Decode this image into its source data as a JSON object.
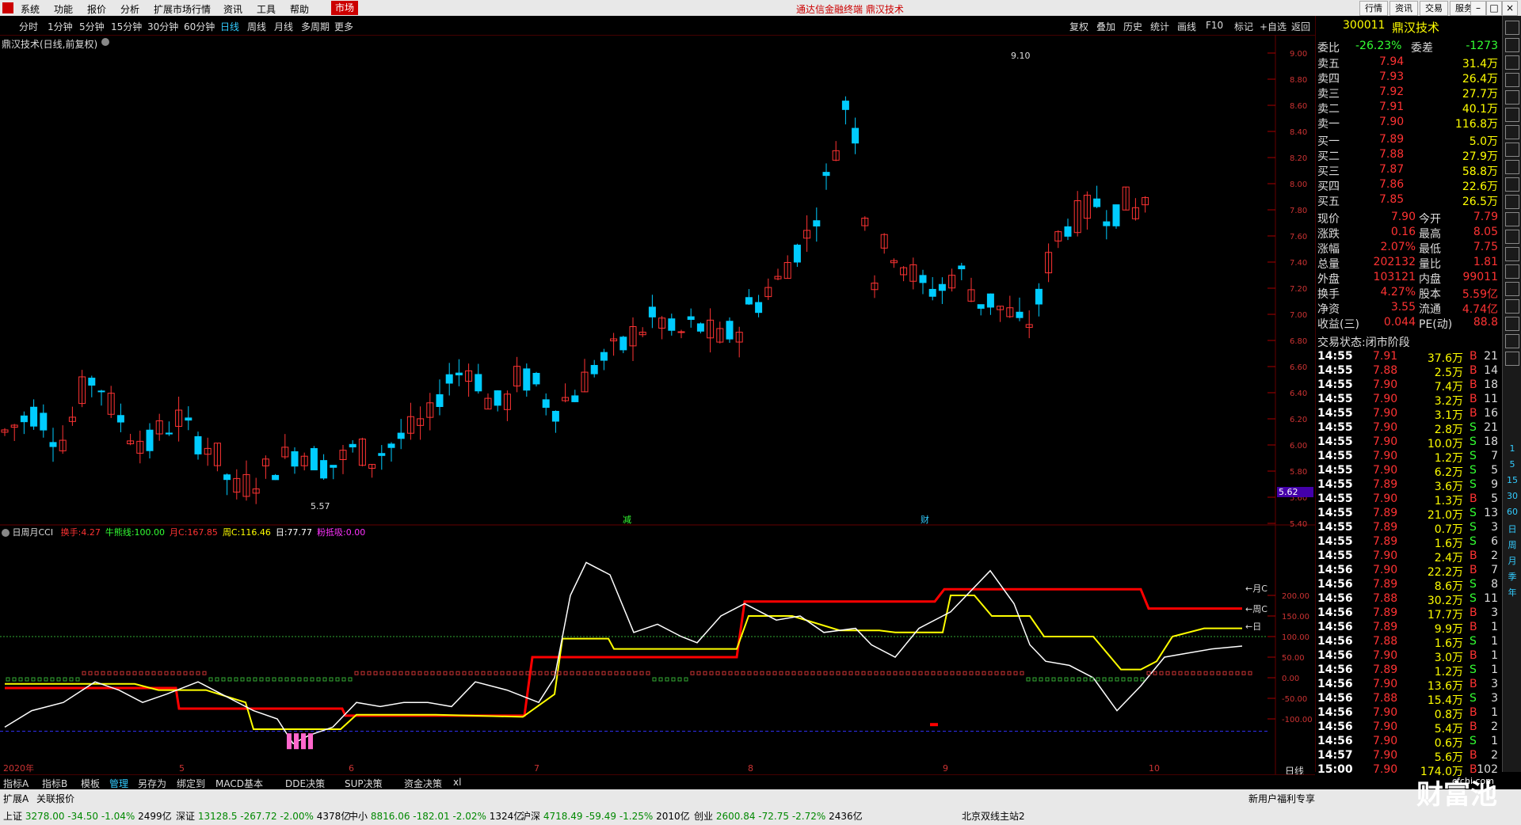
{
  "menubar": {
    "items": [
      "系统",
      "功能",
      "报价",
      "分析",
      "扩展市场行情",
      "资讯",
      "工具",
      "帮助"
    ],
    "market_tab": "市场",
    "center_title": "通达信金融终端  鼎汉技术",
    "right_buttons": [
      "行情",
      "资讯",
      "交易",
      "服务"
    ]
  },
  "period_toolbar": {
    "items": [
      "分时",
      "1分钟",
      "5分钟",
      "15分钟",
      "30分钟",
      "60分钟",
      "日线",
      "周线",
      "月线",
      "多周期",
      "更多"
    ],
    "active": "日线",
    "right_items": [
      "复权",
      "叠加",
      "历史",
      "统计",
      "画线",
      "F10",
      "标记",
      "+自选",
      "返回"
    ]
  },
  "chart": {
    "title": "鼎汉技术(日线,前复权)",
    "price_axis": [
      "9.00",
      "8.80",
      "8.60",
      "8.40",
      "8.20",
      "8.00",
      "7.80",
      "7.60",
      "7.40",
      "7.20",
      "7.00",
      "6.80",
      "6.60",
      "6.40",
      "6.20",
      "6.00",
      "5.80",
      "5.60",
      "5.40"
    ],
    "current_price_tag": "5.62",
    "high_mark": "9.10",
    "low_mark": "5.57",
    "event_marks": [
      "减",
      "财"
    ],
    "indicator": {
      "name": "日周月CCI",
      "params": [
        {
          "label": "换手:",
          "value": "4.27",
          "color": "#f33"
        },
        {
          "label": "牛熊线:",
          "value": "100.00",
          "color": "#3f3"
        },
        {
          "label": "月C:",
          "value": "167.85",
          "color": "#f33"
        },
        {
          "label": "周C:",
          "value": "116.46",
          "color": "#ff0"
        },
        {
          "label": "日:",
          "value": "77.77",
          "color": "#fff"
        },
        {
          "label": "粉抵吸:",
          "value": "0.00",
          "color": "#f3f"
        }
      ],
      "axis": [
        "200.00",
        "150.00",
        "100.00",
        "50.00",
        "0.00",
        "-50.00",
        "-100.00"
      ],
      "line_labels": [
        "←月C",
        "←周C",
        "←日"
      ]
    },
    "date_axis": [
      "2020年",
      "5",
      "6",
      "7",
      "8",
      "9",
      "10"
    ],
    "period_label": "日线"
  },
  "right_panel": {
    "code": "300011",
    "name": "鼎汉技术",
    "weibi_label": "委比",
    "weibi": "-26.23%",
    "weicha_label": "委差",
    "weicha": "-1273",
    "sell": [
      {
        "label": "卖五",
        "price": "7.94",
        "vol": "31.4万"
      },
      {
        "label": "卖四",
        "price": "7.93",
        "vol": "26.4万"
      },
      {
        "label": "卖三",
        "price": "7.92",
        "vol": "27.7万"
      },
      {
        "label": "卖二",
        "price": "7.91",
        "vol": "40.1万"
      },
      {
        "label": "卖一",
        "price": "7.90",
        "vol": "116.8万"
      }
    ],
    "buy": [
      {
        "label": "买一",
        "price": "7.89",
        "vol": "5.0万"
      },
      {
        "label": "买二",
        "price": "7.88",
        "vol": "27.9万"
      },
      {
        "label": "买三",
        "price": "7.87",
        "vol": "58.8万"
      },
      {
        "label": "买四",
        "price": "7.86",
        "vol": "22.6万"
      },
      {
        "label": "买五",
        "price": "7.85",
        "vol": "26.5万"
      }
    ],
    "stats": [
      {
        "l1": "现价",
        "v1": "7.90",
        "l2": "今开",
        "v2": "7.79"
      },
      {
        "l1": "涨跌",
        "v1": "0.16",
        "l2": "最高",
        "v2": "8.05"
      },
      {
        "l1": "涨幅",
        "v1": "2.07%",
        "l2": "最低",
        "v2": "7.75"
      },
      {
        "l1": "总量",
        "v1": "202132",
        "l2": "量比",
        "v2": "1.81"
      },
      {
        "l1": "外盘",
        "v1": "103121",
        "l2": "内盘",
        "v2": "99011"
      },
      {
        "l1": "换手",
        "v1": "4.27%",
        "l2": "股本",
        "v2": "5.59亿"
      },
      {
        "l1": "净资",
        "v1": "3.55",
        "l2": "流通",
        "v2": "4.74亿"
      },
      {
        "l1": "收益(三)",
        "v1": "0.044",
        "l2": "PE(动)",
        "v2": "88.8"
      }
    ],
    "trade_status": "交易状态:闭市阶段",
    "ticks": [
      [
        "14:55",
        "7.91",
        "37.6万",
        "B",
        "21"
      ],
      [
        "14:55",
        "7.88",
        "2.5万",
        "B",
        "14"
      ],
      [
        "14:55",
        "7.90",
        "7.4万",
        "B",
        "18"
      ],
      [
        "14:55",
        "7.90",
        "3.2万",
        "B",
        "11"
      ],
      [
        "14:55",
        "7.90",
        "3.1万",
        "B",
        "16"
      ],
      [
        "14:55",
        "7.90",
        "2.8万",
        "S",
        "21"
      ],
      [
        "14:55",
        "7.90",
        "10.0万",
        "S",
        "18"
      ],
      [
        "14:55",
        "7.90",
        "1.2万",
        "S",
        "7"
      ],
      [
        "14:55",
        "7.90",
        "6.2万",
        "S",
        "5"
      ],
      [
        "14:55",
        "7.89",
        "3.6万",
        "S",
        "9"
      ],
      [
        "14:55",
        "7.90",
        "1.3万",
        "B",
        "5"
      ],
      [
        "14:55",
        "7.89",
        "21.0万",
        "S",
        "13"
      ],
      [
        "14:55",
        "7.89",
        "0.7万",
        "S",
        "3"
      ],
      [
        "14:55",
        "7.89",
        "1.6万",
        "S",
        "6"
      ],
      [
        "14:55",
        "7.90",
        "2.4万",
        "B",
        "2"
      ],
      [
        "14:56",
        "7.90",
        "22.2万",
        "B",
        "7"
      ],
      [
        "14:56",
        "7.89",
        "8.6万",
        "S",
        "8"
      ],
      [
        "14:56",
        "7.88",
        "30.2万",
        "S",
        "11"
      ],
      [
        "14:56",
        "7.89",
        "17.7万",
        "B",
        "3"
      ],
      [
        "14:56",
        "7.89",
        "9.9万",
        "B",
        "1"
      ],
      [
        "14:56",
        "7.88",
        "1.6万",
        "S",
        "1"
      ],
      [
        "14:56",
        "7.90",
        "3.0万",
        "B",
        "1"
      ],
      [
        "14:56",
        "7.89",
        "1.2万",
        "S",
        "1"
      ],
      [
        "14:56",
        "7.90",
        "13.6万",
        "B",
        "3"
      ],
      [
        "14:56",
        "7.88",
        "15.4万",
        "S",
        "3"
      ],
      [
        "14:56",
        "7.90",
        "0.8万",
        "B",
        "1"
      ],
      [
        "14:56",
        "7.90",
        "5.4万",
        "B",
        "2"
      ],
      [
        "14:56",
        "7.90",
        "0.6万",
        "S",
        "1"
      ],
      [
        "14:57",
        "7.90",
        "5.6万",
        "B",
        "2"
      ],
      [
        "15:00",
        "7.90",
        "174.0万",
        "B",
        "102"
      ]
    ]
  },
  "sidebar": {
    "nums": [
      "1",
      "5",
      "15",
      "30",
      "60",
      "日",
      "周",
      "月",
      "季",
      "年"
    ]
  },
  "bottom_tabs": {
    "items": [
      "指标A",
      "指标B",
      "模板",
      "管理",
      "另存为",
      "绑定到",
      "MACD基本",
      "DDE决策",
      "SUP决策",
      "资金决策",
      "xl"
    ],
    "active": "管理"
  },
  "bottom_tabs2": {
    "items": [
      "扩展A",
      "关联报价"
    ],
    "right": "新用户福利专享"
  },
  "status_bar": [
    {
      "name": "上证",
      "v": "3278.00",
      "c": "-34.50",
      "p": "-1.04%",
      "amt": "2499亿"
    },
    {
      "name": "深证",
      "v": "13128.5",
      "c": "-267.72",
      "p": "-2.00%",
      "amt": "4378亿"
    },
    {
      "name": "中小",
      "v": "8816.06",
      "c": "-182.01",
      "p": "-2.02%",
      "amt": "1324亿"
    },
    {
      "name": "沪深",
      "v": "4718.49",
      "c": "-59.49",
      "p": "-1.25%",
      "amt": "2010亿"
    },
    {
      "name": "创业",
      "v": "2600.84",
      "c": "-72.75",
      "p": "-2.72%",
      "amt": "2436亿"
    }
  ],
  "status_right": "北京双线主站2",
  "watermark": "财富池",
  "watermark_url": "cfchi.com",
  "colors": {
    "up": "#f33",
    "down": "#0cf",
    "bg": "#000",
    "month": "#f00",
    "week": "#ff0",
    "day": "#fff"
  }
}
